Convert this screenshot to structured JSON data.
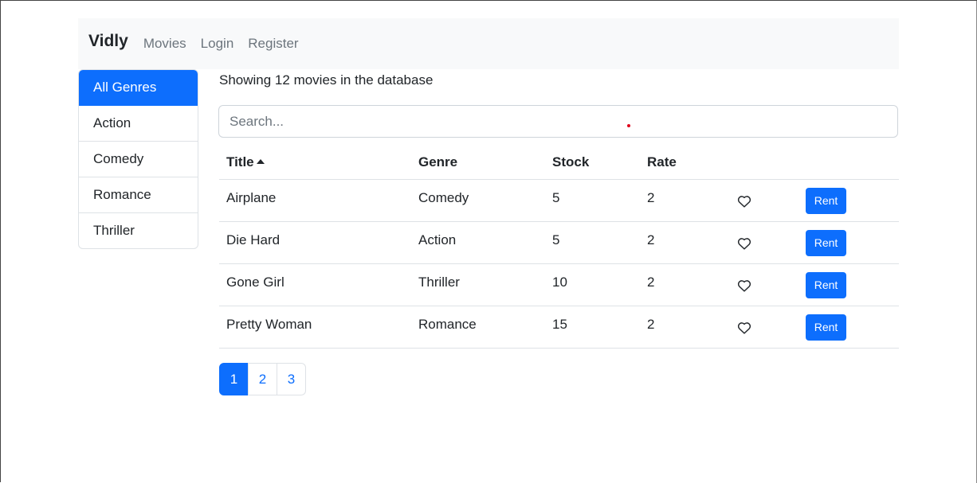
{
  "navbar": {
    "brand": "Vidly",
    "links": [
      "Movies",
      "Login",
      "Register"
    ]
  },
  "genres": {
    "active_index": 0,
    "items": [
      "All Genres",
      "Action",
      "Comedy",
      "Romance",
      "Thriller"
    ]
  },
  "main": {
    "count_text": "Showing 12 movies in the database",
    "search": {
      "placeholder": "Search...",
      "value": ""
    },
    "table": {
      "headers": [
        "Title",
        "Genre",
        "Stock",
        "Rate"
      ],
      "sort_column": "Title",
      "sort_order": "asc",
      "rows": [
        {
          "title": "Airplane",
          "genre": "Comedy",
          "stock": "5",
          "rate": "2",
          "liked": false,
          "action_label": "Rent"
        },
        {
          "title": "Die Hard",
          "genre": "Action",
          "stock": "5",
          "rate": "2",
          "liked": false,
          "action_label": "Rent"
        },
        {
          "title": "Gone Girl",
          "genre": "Thriller",
          "stock": "10",
          "rate": "2",
          "liked": false,
          "action_label": "Rent"
        },
        {
          "title": "Pretty Woman",
          "genre": "Romance",
          "stock": "15",
          "rate": "2",
          "liked": false,
          "action_label": "Rent"
        }
      ]
    },
    "pagination": {
      "pages": [
        "1",
        "2",
        "3"
      ],
      "current": "1"
    }
  },
  "colors": {
    "primary": "#0d6efd",
    "navbar_bg": "#f8f9fa",
    "muted_text": "#6c757d",
    "border": "#dee2e6"
  },
  "icons": {
    "sort": "caret-up-icon",
    "like": "heart-outline-icon"
  }
}
